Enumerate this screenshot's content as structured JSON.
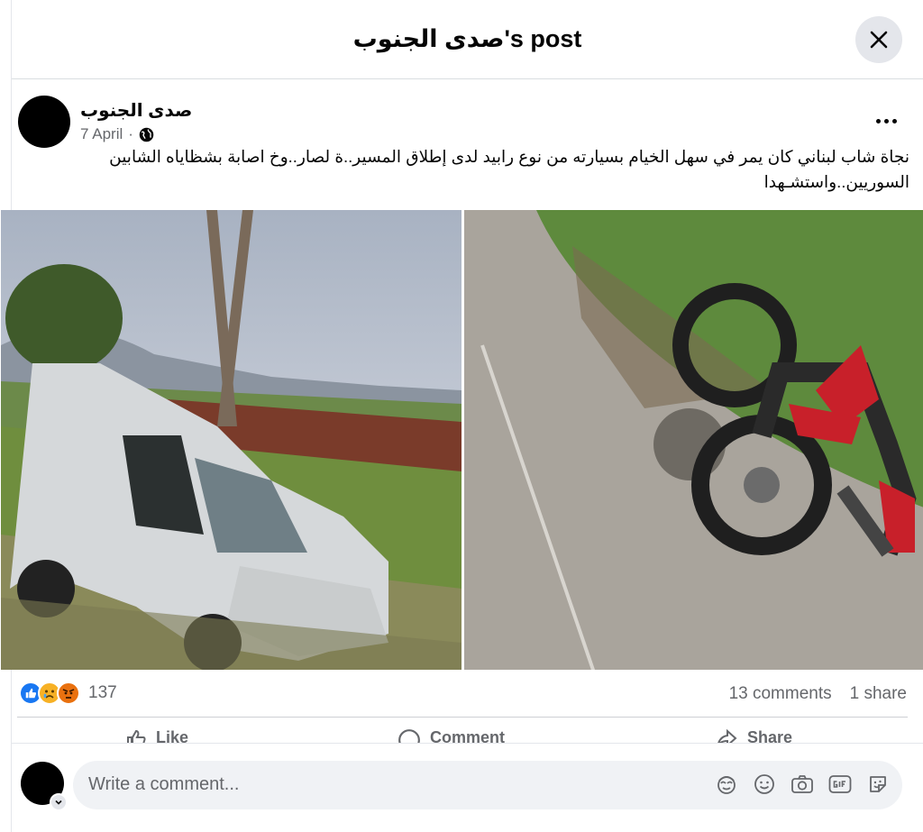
{
  "header": {
    "title": "صدى الجنوب's post"
  },
  "post": {
    "author": "صدى الجنوب",
    "date": "7 April",
    "separator": "·",
    "text": "نجاة شاب لبناني كان يمر في سهل الخيام بسيارته من نوع رابيد لدى إطلاق المسير..ة لصار..وخ اصابة بشظاياه الشابين السوريين..واستشـهدا"
  },
  "engagement": {
    "reaction_icons": [
      "like-icon",
      "sad-icon",
      "angry-icon"
    ],
    "reaction_count": "137",
    "comments": "13 comments",
    "shares": "1 share"
  },
  "actions": {
    "like": "Like",
    "comment": "Comment",
    "share": "Share"
  },
  "comment_box": {
    "placeholder": "Write a comment...",
    "icons": [
      "avatar-sticker-icon",
      "emoji-icon",
      "camera-icon",
      "gif-icon",
      "sticker-icon"
    ]
  },
  "colors": {
    "like": "#1877f2",
    "sad": "#f7b125",
    "angry": "#e9710f",
    "muted": "#65676b"
  }
}
